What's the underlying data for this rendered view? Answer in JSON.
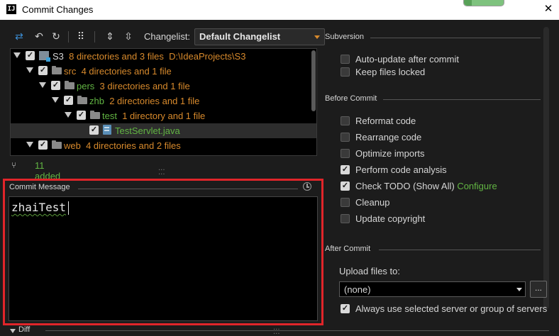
{
  "window": {
    "title": "Commit Changes",
    "app_icon_text": "IJ",
    "close_glyph": "✕",
    "memory_indicator_fraction": 0.2
  },
  "toolbar": {
    "buttons": [
      {
        "name": "show-diff-icon",
        "glyph": "⇄"
      },
      {
        "name": "rollback-icon",
        "glyph": "↶"
      },
      {
        "name": "refresh-icon",
        "glyph": "↻"
      },
      {
        "name": "group-by-icon",
        "glyph": "⠿"
      },
      {
        "name": "expand-all-icon",
        "glyph": "⇕"
      },
      {
        "name": "collapse-all-icon",
        "glyph": "⇳"
      }
    ],
    "changelist_label": "Changelist:",
    "changelist_value": "Default Changelist"
  },
  "tree": {
    "rows": [
      {
        "name": "S3",
        "count": "8 directories and 3 files",
        "path": "D:\\IdeaProjects\\S3"
      },
      {
        "name": "src",
        "count": "4 directories and 1 file"
      },
      {
        "name": "pers",
        "count": "3 directories and 1 file"
      },
      {
        "name": "zhb",
        "count": "2 directories and 1 file"
      },
      {
        "name": "test",
        "count": "1 directory and 1 file"
      },
      {
        "name": "TestServlet.java",
        "count": ""
      },
      {
        "name": "web",
        "count": "4 directories and 2 files"
      }
    ]
  },
  "status": {
    "added_text": "11 added"
  },
  "commit_message": {
    "label": "Commit Message",
    "text": "zhaiTest"
  },
  "diff": {
    "label": "Diff"
  },
  "sections": {
    "subversion": {
      "title": "Subversion",
      "options": [
        {
          "label": "Auto-update after commit",
          "checked": false
        },
        {
          "label": "Keep files locked",
          "checked": false
        }
      ]
    },
    "before_commit": {
      "title": "Before Commit",
      "options": [
        {
          "label": "Reformat code",
          "checked": false
        },
        {
          "label": "Rearrange code",
          "checked": false
        },
        {
          "label": "Optimize imports",
          "checked": false
        },
        {
          "label": "Perform code analysis",
          "checked": true
        },
        {
          "label": "Check TODO (Show All)",
          "checked": true,
          "link": "Configure"
        },
        {
          "label": "Cleanup",
          "checked": false
        },
        {
          "label": "Update copyright",
          "checked": false
        }
      ]
    },
    "after_commit": {
      "title": "After Commit",
      "upload_label": "Upload files to:",
      "upload_value": "(none)",
      "browse_label": "...",
      "always_use": {
        "label": "Always use selected server or group of servers",
        "checked": true
      }
    }
  },
  "colors": {
    "accent_orange": "#d88a2c",
    "added_green": "#62b543",
    "highlight_red": "#e0252a"
  }
}
